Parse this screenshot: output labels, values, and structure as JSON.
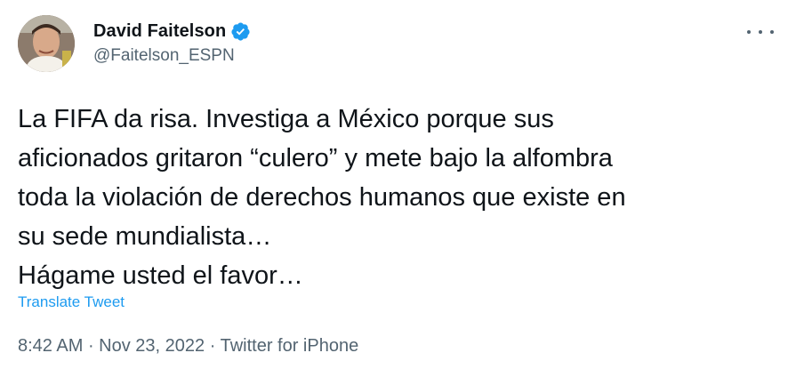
{
  "author": {
    "display_name": "David Faitelson",
    "handle": "@Faitelson_ESPN",
    "verified_icon": "verified-badge-icon",
    "avatar_icon": "avatar-photo"
  },
  "more_menu_icon": "more-options-icon",
  "tweet": {
    "lines": [
      "La FIFA da risa. Investiga a México porque sus",
      "aficionados gritaron “culero” y mete bajo la alfombra",
      "toda la violación de derechos humanos que existe en",
      "su sede mundialista…",
      "Hágame usted el favor…"
    ],
    "translate_label": "Translate Tweet"
  },
  "meta": {
    "time": "8:42 AM",
    "separator": " · ",
    "date": "Nov 23, 2022",
    "source": "Twitter for iPhone"
  },
  "colors": {
    "accent": "#1d9bf0",
    "text": "#0f1419",
    "secondary": "#536471"
  }
}
